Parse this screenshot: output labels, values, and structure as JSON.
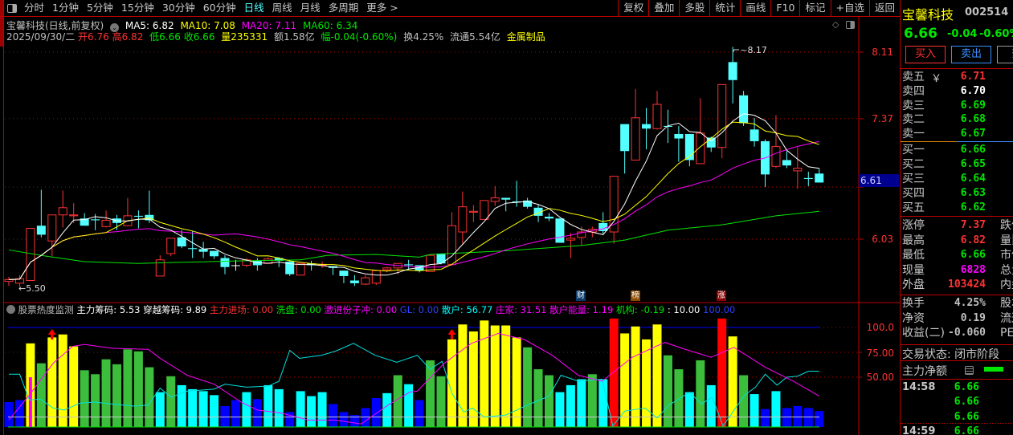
{
  "toolbar": {
    "left_items": [
      "分时",
      "1分钟",
      "5分钟",
      "15分钟",
      "30分钟",
      "60分钟",
      "日线",
      "周线",
      "月线",
      "多周期",
      "更多 >"
    ],
    "active_index": 6,
    "right_items": [
      "复权",
      "叠加",
      "多股",
      "统计",
      "画线",
      "F10",
      "标记",
      "+自选",
      "返回"
    ]
  },
  "header": {
    "title": "宝馨科技(日线,前复权)",
    "ma5": "MA5: 6.82",
    "ma10": "MA10: 7.08",
    "ma20": "MA20: 7.11",
    "ma60": "MA60: 6.34",
    "date": "2025/09/30/二",
    "open": "开6.76",
    "high": "高6.82",
    "low": "低6.66",
    "close": "收6.66",
    "volume": "量235331",
    "amount": "额1.58亿",
    "change": "幅-0.04(-0.60%)",
    "turnover": "换4.25%",
    "float": "流通5.54亿",
    "industry": "金属制品"
  },
  "price_axis": {
    "labels": [
      "8.11",
      "7.37",
      "6.03"
    ],
    "cursor_price": "6.61"
  },
  "annotations": {
    "high_label": "8.17",
    "low_label": "5.50",
    "tags": [
      "财",
      "榜",
      "涨"
    ]
  },
  "indicator": {
    "title": "股票热度监测",
    "items": [
      "主力筹码: 5.53",
      "穿越筹码: 9.89",
      "主力进场: 0.00",
      "洗盘: 0.00",
      "激进份子冲: 0.00",
      "GL: 0.00",
      "散户: 56.77",
      "庄家: 31.51",
      "散户能量: 1.19",
      "机构: -0.19",
      ": 10.00",
      "100.00"
    ],
    "axis_labels": [
      "100.0",
      "75.00",
      "50.00"
    ]
  },
  "colors": {
    "up": "#ff3232",
    "down": "#54ffff",
    "ma5": "#ffffff",
    "ma10": "#ffff00",
    "ma20": "#ff00ff",
    "ma60": "#00e600",
    "Y": "#ffff00",
    "G": "#3cbe3c",
    "C": "#00ffff",
    "B": "#0000ff",
    "R": "#ff0000"
  },
  "chart_data": {
    "type": "candlestick",
    "price_range": [
      5.45,
      8.3
    ],
    "candles_ohlc": [
      [
        5.56,
        5.61,
        5.51,
        5.58
      ],
      [
        5.54,
        5.63,
        5.5,
        5.59
      ],
      [
        5.57,
        6.15,
        5.57,
        6.15
      ],
      [
        6.18,
        6.58,
        6.05,
        6.08
      ],
      [
        6.01,
        6.3,
        5.84,
        6.3
      ],
      [
        6.3,
        6.57,
        6.16,
        6.38
      ],
      [
        6.29,
        6.43,
        6.21,
        6.3
      ],
      [
        6.26,
        6.32,
        6.18,
        6.18
      ],
      [
        6.25,
        6.31,
        6.13,
        6.24
      ],
      [
        6.17,
        6.35,
        6.16,
        6.24
      ],
      [
        6.26,
        6.3,
        6.13,
        6.21
      ],
      [
        6.18,
        6.49,
        6.18,
        6.29
      ],
      [
        6.29,
        6.35,
        6.15,
        6.28
      ],
      [
        6.3,
        6.57,
        6.21,
        6.24
      ],
      [
        5.62,
        5.85,
        5.62,
        5.8
      ],
      [
        5.87,
        6.04,
        5.84,
        6.04
      ],
      [
        6.05,
        6.13,
        5.93,
        5.95
      ],
      [
        5.93,
        6.12,
        5.82,
        5.92
      ],
      [
        5.92,
        6.0,
        5.82,
        5.89
      ],
      [
        5.9,
        5.9,
        5.81,
        5.84
      ],
      [
        5.82,
        5.85,
        5.64,
        5.72
      ],
      [
        5.74,
        5.8,
        5.68,
        5.74
      ],
      [
        5.74,
        5.82,
        5.72,
        5.8
      ],
      [
        5.79,
        5.82,
        5.68,
        5.74
      ],
      [
        5.76,
        5.83,
        5.76,
        5.81
      ],
      [
        5.82,
        5.83,
        5.72,
        5.79
      ],
      [
        5.78,
        5.79,
        5.62,
        5.64
      ],
      [
        5.63,
        5.76,
        5.63,
        5.76
      ],
      [
        5.76,
        5.79,
        5.68,
        5.74
      ],
      [
        5.74,
        5.78,
        5.71,
        5.75
      ],
      [
        5.73,
        5.73,
        5.63,
        5.71
      ],
      [
        5.68,
        5.68,
        5.54,
        5.62
      ],
      [
        5.57,
        5.63,
        5.51,
        5.54
      ],
      [
        5.53,
        5.63,
        5.52,
        5.6
      ],
      [
        5.54,
        5.69,
        5.52,
        5.68
      ],
      [
        5.69,
        5.72,
        5.66,
        5.71
      ],
      [
        5.71,
        5.76,
        5.64,
        5.76
      ],
      [
        5.75,
        5.8,
        5.69,
        5.74
      ],
      [
        5.74,
        5.74,
        5.66,
        5.68
      ],
      [
        5.67,
        5.85,
        5.67,
        5.85
      ],
      [
        5.87,
        5.87,
        5.75,
        5.76
      ],
      [
        5.75,
        6.33,
        5.75,
        6.18
      ],
      [
        6.11,
        6.56,
        5.98,
        6.39
      ],
      [
        6.33,
        6.41,
        6.22,
        6.34
      ],
      [
        6.25,
        6.46,
        6.25,
        6.46
      ],
      [
        6.45,
        6.62,
        6.4,
        6.49
      ],
      [
        6.49,
        6.49,
        6.34,
        6.47
      ],
      [
        6.45,
        6.68,
        6.39,
        6.44
      ],
      [
        6.46,
        6.49,
        6.37,
        6.39
      ],
      [
        6.38,
        6.42,
        6.22,
        6.29
      ],
      [
        6.28,
        6.32,
        6.23,
        6.26
      ],
      [
        6.26,
        6.26,
        5.99,
        5.99
      ],
      [
        6.02,
        6.1,
        5.82,
        6.04
      ],
      [
        6.05,
        6.17,
        5.96,
        6.11
      ],
      [
        6.11,
        6.17,
        6.05,
        6.14
      ],
      [
        6.21,
        6.33,
        6.09,
        6.12
      ],
      [
        6.11,
        6.73,
        5.98,
        6.73
      ],
      [
        7.31,
        7.31,
        6.76,
        7.01
      ],
      [
        6.91,
        7.7,
        6.91,
        7.38
      ],
      [
        7.31,
        7.49,
        7.03,
        7.26
      ],
      [
        7.26,
        7.68,
        7.25,
        7.53
      ],
      [
        7.29,
        7.47,
        7.1,
        7.28
      ],
      [
        7.2,
        7.29,
        6.89,
        7.15
      ],
      [
        7.2,
        7.2,
        6.84,
        6.91
      ],
      [
        6.87,
        7.6,
        6.87,
        7.21
      ],
      [
        7.16,
        7.17,
        7.0,
        7.05
      ],
      [
        7.05,
        7.75,
        6.93,
        7.75
      ],
      [
        8.0,
        8.17,
        7.54,
        7.8
      ],
      [
        7.63,
        7.68,
        7.29,
        7.32
      ],
      [
        7.25,
        7.38,
        7.06,
        7.12
      ],
      [
        7.12,
        7.14,
        6.61,
        6.75
      ],
      [
        6.84,
        7.41,
        6.82,
        7.06
      ],
      [
        6.91,
        7.01,
        6.82,
        6.85
      ],
      [
        6.79,
        7.05,
        6.59,
        6.82
      ],
      [
        6.71,
        6.78,
        6.62,
        6.7
      ],
      [
        6.76,
        6.82,
        6.66,
        6.66
      ]
    ],
    "ma60_points": [
      [
        0,
        5.91
      ],
      [
        3.5,
        5.84
      ],
      [
        7,
        5.78
      ],
      [
        12,
        5.76
      ],
      [
        15,
        5.77
      ],
      [
        22,
        5.79
      ],
      [
        27,
        5.8
      ],
      [
        29.5,
        5.85
      ],
      [
        34,
        5.86
      ],
      [
        38,
        5.83
      ],
      [
        39,
        5.86
      ],
      [
        46,
        5.9
      ],
      [
        53,
        5.96
      ],
      [
        57,
        6.02
      ],
      [
        61,
        6.13
      ],
      [
        66,
        6.19
      ],
      [
        71,
        6.29
      ],
      [
        75,
        6.34
      ]
    ],
    "indicator_range": [
      0,
      100
    ],
    "indicator_bars": [
      [
        25,
        "B"
      ],
      [
        27,
        "B"
      ],
      [
        84,
        "Y"
      ],
      [
        64,
        "G"
      ],
      [
        90,
        "Y"
      ],
      [
        93,
        "Y"
      ],
      [
        81,
        "Y"
      ],
      [
        57,
        "G"
      ],
      [
        53,
        "G"
      ],
      [
        68,
        "G"
      ],
      [
        63,
        "G"
      ],
      [
        78,
        "G"
      ],
      [
        76,
        "G"
      ],
      [
        60,
        "G"
      ],
      [
        35,
        "C"
      ],
      [
        51,
        "G"
      ],
      [
        42,
        "C"
      ],
      [
        38,
        "C"
      ],
      [
        36,
        "C"
      ],
      [
        32,
        "C"
      ],
      [
        21,
        "B"
      ],
      [
        27,
        "B"
      ],
      [
        35,
        "C"
      ],
      [
        28,
        "B"
      ],
      [
        42,
        "C"
      ],
      [
        38,
        "C"
      ],
      [
        15,
        "B"
      ],
      [
        36,
        "C"
      ],
      [
        31,
        "C"
      ],
      [
        35,
        "C"
      ],
      [
        23,
        "B"
      ],
      [
        15,
        "B"
      ],
      [
        12,
        "B"
      ],
      [
        19,
        "B"
      ],
      [
        29,
        "B"
      ],
      [
        34,
        "C"
      ],
      [
        52,
        "G"
      ],
      [
        43,
        "C"
      ],
      [
        27,
        "B"
      ],
      [
        67,
        "G"
      ],
      [
        51,
        "G"
      ],
      [
        88,
        "Y"
      ],
      [
        103,
        "Y"
      ],
      [
        96,
        "Y"
      ],
      [
        107,
        "Y"
      ],
      [
        102,
        "Y"
      ],
      [
        102,
        "Y"
      ],
      [
        90,
        "Y"
      ],
      [
        80,
        "G"
      ],
      [
        58,
        "G"
      ],
      [
        52,
        "G"
      ],
      [
        35,
        "C"
      ],
      [
        42,
        "C"
      ],
      [
        48,
        "C"
      ],
      [
        53,
        "G"
      ],
      [
        48,
        "C"
      ],
      [
        110,
        "R"
      ],
      [
        94,
        "Y"
      ],
      [
        101,
        "Y"
      ],
      [
        88,
        "Y"
      ],
      [
        103,
        "Y"
      ],
      [
        72,
        "G"
      ],
      [
        58,
        "G"
      ],
      [
        35,
        "C"
      ],
      [
        67,
        "G"
      ],
      [
        42,
        "C"
      ],
      [
        110,
        "R"
      ],
      [
        91,
        "Y"
      ],
      [
        52,
        "G"
      ],
      [
        33,
        "C"
      ],
      [
        18,
        "B"
      ],
      [
        36,
        "C"
      ],
      [
        19,
        "B"
      ],
      [
        21,
        "B"
      ],
      [
        19,
        "B"
      ],
      [
        16,
        "B"
      ]
    ],
    "magenta_line": [
      [
        0,
        7
      ],
      [
        1.9,
        32
      ],
      [
        4.1,
        64
      ],
      [
        5.9,
        81
      ],
      [
        7,
        83
      ],
      [
        9.6,
        79
      ],
      [
        12.9,
        78
      ],
      [
        14,
        69
      ],
      [
        16.5,
        52
      ],
      [
        19,
        43
      ],
      [
        21.5,
        25
      ],
      [
        23,
        17
      ],
      [
        25.2,
        14
      ],
      [
        27.7,
        7
      ],
      [
        30.2,
        7
      ],
      [
        32.6,
        3
      ],
      [
        35.1,
        22
      ],
      [
        37.1,
        35
      ],
      [
        37.8,
        36
      ],
      [
        40.3,
        64
      ],
      [
        42.8,
        84
      ],
      [
        45.3,
        94
      ],
      [
        47.7,
        88
      ],
      [
        50.3,
        72
      ],
      [
        52.7,
        52
      ],
      [
        54.9,
        46
      ],
      [
        57.7,
        70
      ],
      [
        60.7,
        85
      ],
      [
        62.6,
        78
      ],
      [
        65,
        70
      ],
      [
        67.1,
        80
      ],
      [
        70,
        60
      ],
      [
        72.6,
        46
      ],
      [
        75,
        31
      ]
    ],
    "cyan_line": [
      [
        0,
        53
      ],
      [
        1,
        53
      ],
      [
        1.9,
        27
      ],
      [
        2.9,
        28
      ],
      [
        4.1,
        19
      ],
      [
        5.1,
        17
      ],
      [
        6.6,
        24
      ],
      [
        7.9,
        25
      ],
      [
        9.6,
        23
      ],
      [
        11.6,
        21
      ],
      [
        12.9,
        22
      ],
      [
        14,
        39
      ],
      [
        15,
        30
      ],
      [
        16.5,
        36
      ],
      [
        19,
        38
      ],
      [
        20,
        43
      ],
      [
        22,
        40
      ],
      [
        24,
        41
      ],
      [
        25,
        46
      ],
      [
        26,
        77
      ],
      [
        26.9,
        69
      ],
      [
        28.9,
        72
      ],
      [
        30.2,
        76
      ],
      [
        31.9,
        84
      ],
      [
        33.9,
        72
      ],
      [
        35.9,
        65
      ],
      [
        37.8,
        72
      ],
      [
        39,
        58
      ],
      [
        40.1,
        66
      ],
      [
        41,
        34
      ],
      [
        42.1,
        15
      ],
      [
        42.9,
        19
      ],
      [
        44,
        10
      ],
      [
        46,
        12
      ],
      [
        48,
        22
      ],
      [
        50,
        31
      ],
      [
        51.1,
        52
      ],
      [
        52.7,
        46
      ],
      [
        54.9,
        48
      ],
      [
        55.9,
        1
      ],
      [
        57,
        16
      ],
      [
        58.9,
        19
      ],
      [
        60,
        9
      ],
      [
        61.1,
        22
      ],
      [
        63,
        35
      ],
      [
        64.1,
        23
      ],
      [
        65.1,
        30
      ],
      [
        66.1,
        1
      ],
      [
        68.1,
        32
      ],
      [
        69.1,
        40
      ],
      [
        70,
        53
      ],
      [
        71.1,
        42
      ],
      [
        72,
        50
      ],
      [
        73,
        51
      ],
      [
        74,
        56
      ],
      [
        75,
        56
      ]
    ],
    "reference_line": 10,
    "signal_arrows_at": [
      4,
      41
    ],
    "tag_positions": [
      53,
      58,
      66
    ]
  },
  "right_panel": {
    "name": "宝馨科技",
    "code": "002514",
    "price": "6.66",
    "change": "-0.04",
    "change_pct": "-0.60%",
    "buy_label": "买入",
    "sell_label": "卖出",
    "query_label": "查",
    "asks": [
      {
        "label": "卖五",
        "extra": "￥",
        "price": "6.71",
        "color": "r"
      },
      {
        "label": "卖四",
        "price": "6.70",
        "color": "w"
      },
      {
        "label": "卖三",
        "price": "6.69",
        "color": "g"
      },
      {
        "label": "卖二",
        "price": "6.68",
        "color": "g"
      },
      {
        "label": "卖一",
        "price": "6.67",
        "color": "g"
      }
    ],
    "bids": [
      {
        "label": "买一",
        "price": "6.66",
        "color": "g"
      },
      {
        "label": "买二",
        "price": "6.65",
        "color": "g"
      },
      {
        "label": "买三",
        "price": "6.64",
        "color": "g"
      },
      {
        "label": "买四",
        "price": "6.63",
        "color": "g"
      },
      {
        "label": "买五",
        "price": "6.62",
        "color": "g"
      }
    ],
    "stats": [
      {
        "label": "涨停",
        "value": "7.37",
        "color": "r",
        "right": "跌停"
      },
      {
        "label": "最高",
        "value": "6.82",
        "color": "r",
        "right": "量比"
      },
      {
        "label": "最低",
        "value": "6.66",
        "color": "g",
        "right": "市值"
      },
      {
        "label": "现量",
        "value": "6828",
        "color": "m",
        "right": "总量"
      },
      {
        "label": "外盘",
        "value": "103424",
        "color": "r",
        "right": "内盘"
      }
    ],
    "stats2": [
      {
        "label": "换手",
        "value": "4.25%",
        "right": "股本"
      },
      {
        "label": "净资",
        "value": "0.19",
        "right": "流通"
      },
      {
        "label": "收益(二)",
        "value": "-0.060",
        "right": "PE(动)"
      }
    ],
    "trade_status": "交易状态: 闭市阶段",
    "net_main": "主力净额",
    "ticks": [
      {
        "time": "14:58",
        "price": "6.66"
      },
      {
        "time": "",
        "price": "6.66"
      },
      {
        "time": "",
        "price": "6.66"
      },
      {
        "time": "14:59",
        "price": "6.66"
      }
    ]
  }
}
